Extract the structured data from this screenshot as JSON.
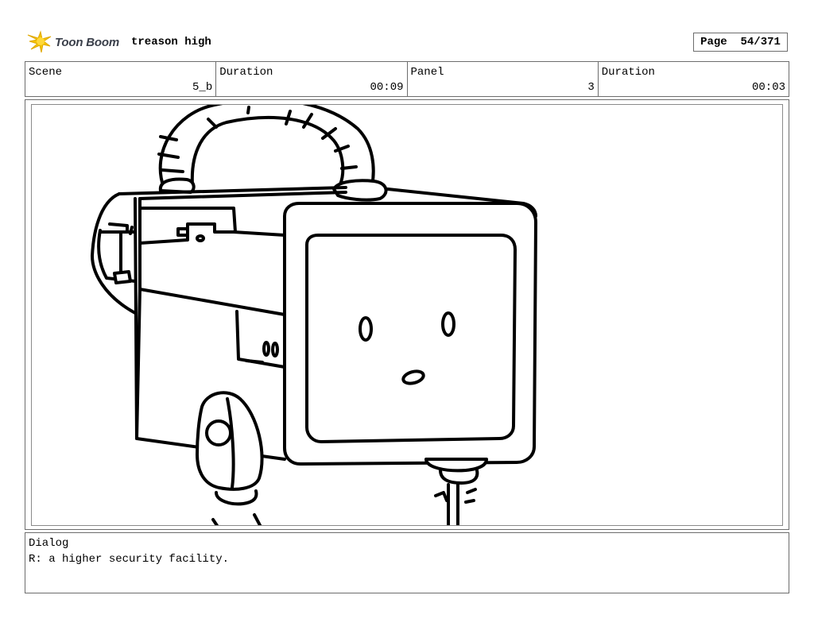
{
  "header": {
    "logo_text": "Toon Boom",
    "project_title": "treason high",
    "page_label": "Page",
    "page_number": "54/371"
  },
  "info": {
    "scene_label": "Scene",
    "scene_value": "5_b",
    "scene_duration_label": "Duration",
    "scene_duration_value": "00:09",
    "panel_label": "Panel",
    "panel_value": "3",
    "panel_duration_label": "Duration",
    "panel_duration_value": "00:03"
  },
  "dialog": {
    "label": "Dialog",
    "text": "R: a higher security facility."
  },
  "icons": {
    "logo": "toon-boom-star-logo-icon"
  },
  "colors": {
    "border": "#6d6d6d",
    "logo_yellow": "#f5c400",
    "logo_text": "#3a3f4a"
  }
}
